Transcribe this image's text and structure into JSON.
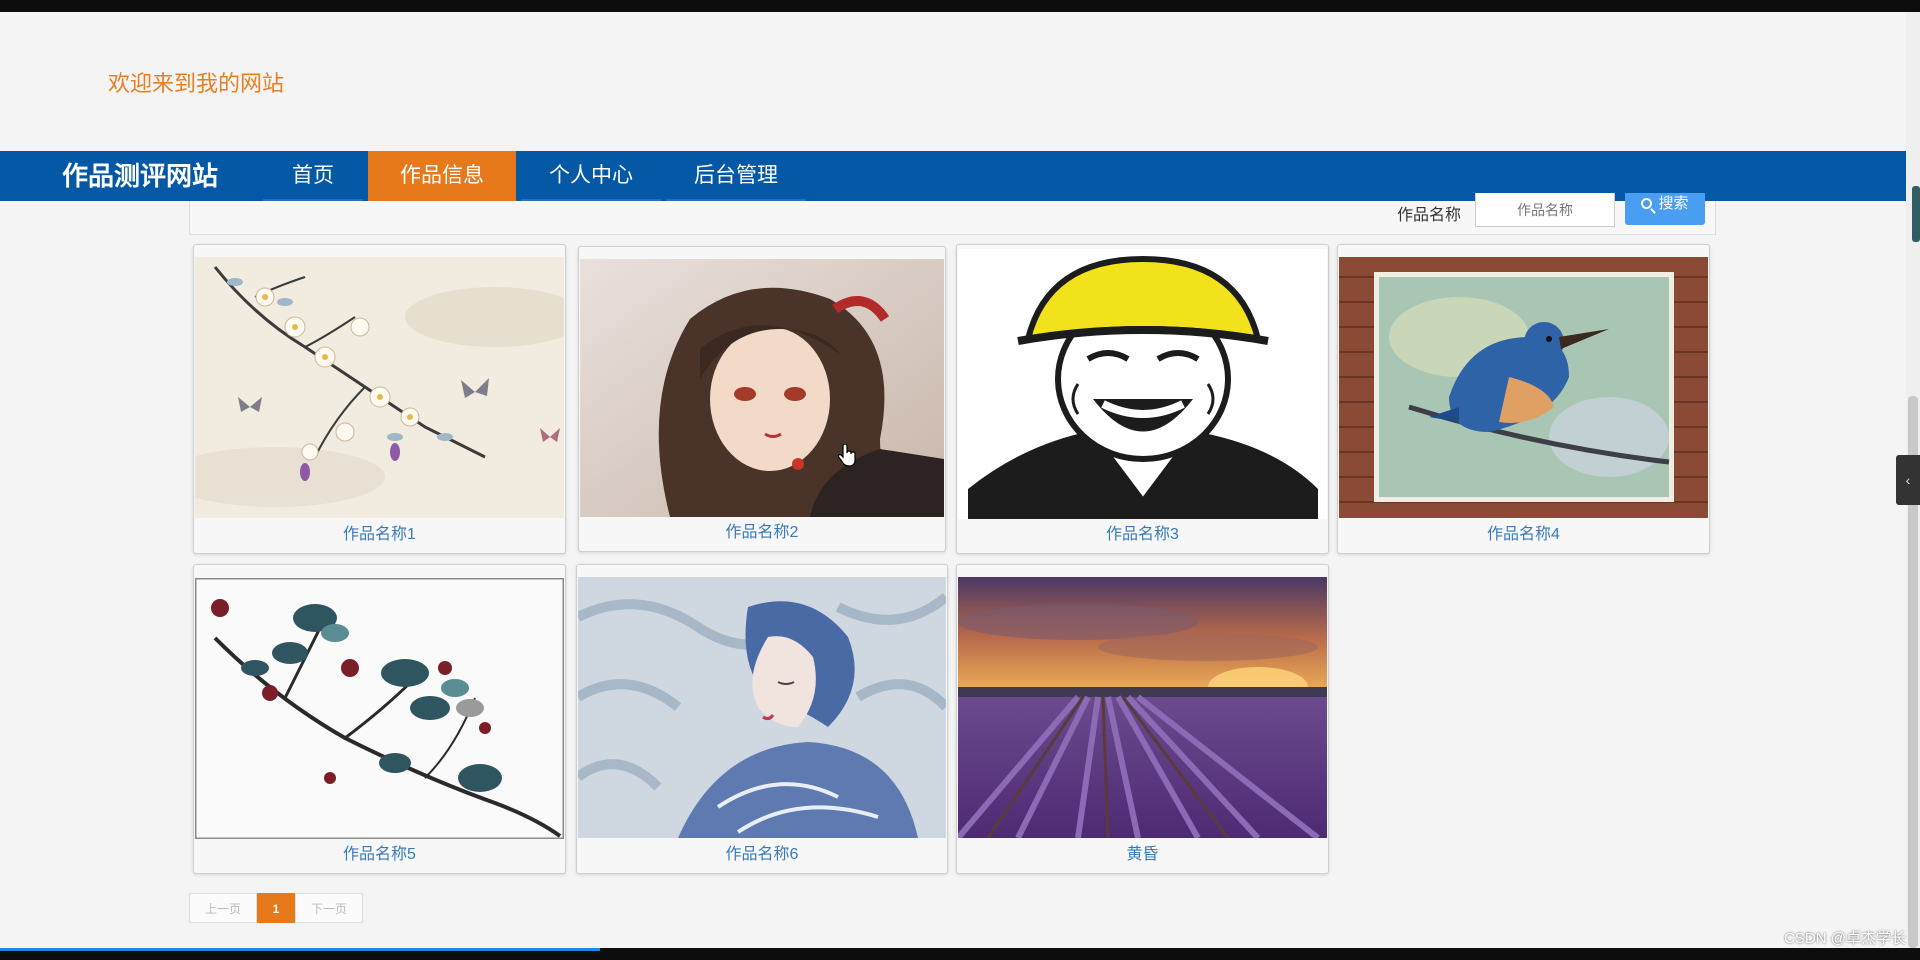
{
  "header": {
    "welcome_text": "欢迎来到我的网站"
  },
  "navbar": {
    "brand": "作品测评网站",
    "items": [
      {
        "label": "首页",
        "active": false
      },
      {
        "label": "作品信息",
        "active": true
      },
      {
        "label": "个人中心",
        "active": false
      },
      {
        "label": "后台管理",
        "active": false
      }
    ],
    "bg_color": "#0458a6",
    "active_color": "#e8791a"
  },
  "search": {
    "label": "作品名称",
    "placeholder": "作品名称",
    "button_label": "搜索",
    "button_icon": "search-icon"
  },
  "works": [
    {
      "title": "作品名称1",
      "image": "flowers-and-butterflies-painting"
    },
    {
      "title": "作品名称2",
      "image": "anime-girl-portrait"
    },
    {
      "title": "作品名称3",
      "image": "laughing-man-helmet-meme"
    },
    {
      "title": "作品名称4",
      "image": "kingfisher-painting"
    },
    {
      "title": "作品名称5",
      "image": "ink-branch-berries"
    },
    {
      "title": "作品名称6",
      "image": "blue-hair-boy-illustration"
    },
    {
      "title": "黄昏",
      "image": "lavender-field-sunset"
    }
  ],
  "pagination": {
    "prev": "上一页",
    "current": "1",
    "next": "下一页"
  },
  "watermark": "CSDN @卓杰学长"
}
